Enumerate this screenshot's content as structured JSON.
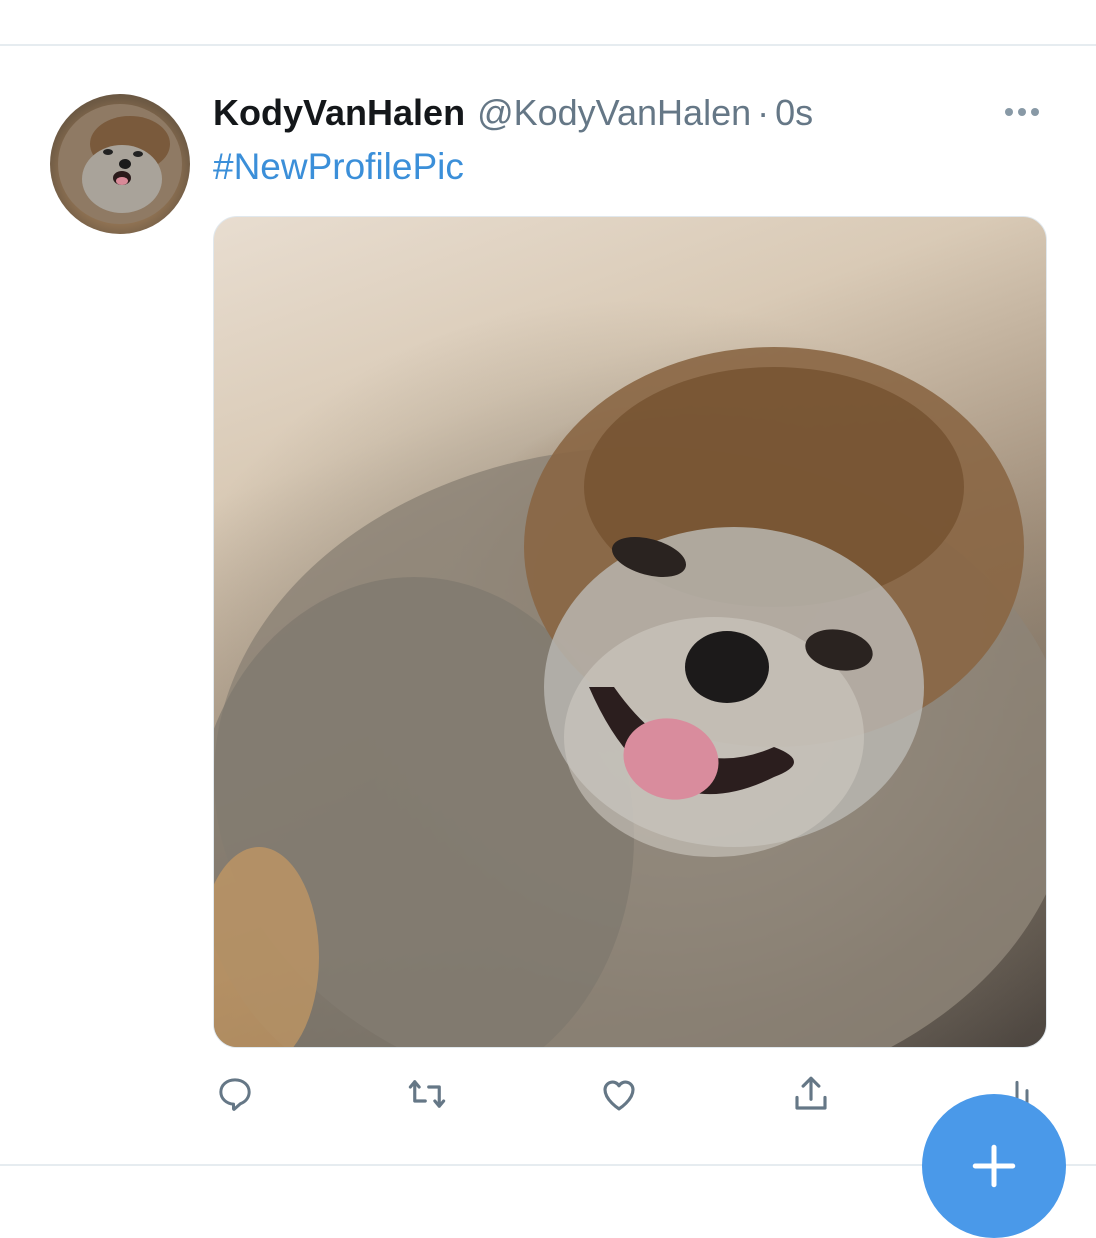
{
  "tweet": {
    "author": {
      "display_name": "KodyVanHalen",
      "handle": "@KodyVanHalen",
      "separator": "·",
      "timestamp": "0s",
      "avatar_description": "profile photo of a fluffy Pomeranian dog"
    },
    "text": "#NewProfilePic",
    "media": {
      "alt": "close-up photo of a smiling fluffy Pomeranian dog"
    },
    "actions": {
      "reply_icon": "reply-icon",
      "retweet_icon": "retweet-icon",
      "like_icon": "like-icon",
      "share_icon": "share-icon",
      "analytics_icon": "analytics-icon"
    },
    "more_icon": "more-icon"
  },
  "fab": {
    "icon": "plus-icon"
  },
  "colors": {
    "link": "#3b8fd9",
    "fab": "#4a99e9",
    "icon_gray": "#657786",
    "text": "#14171a"
  }
}
